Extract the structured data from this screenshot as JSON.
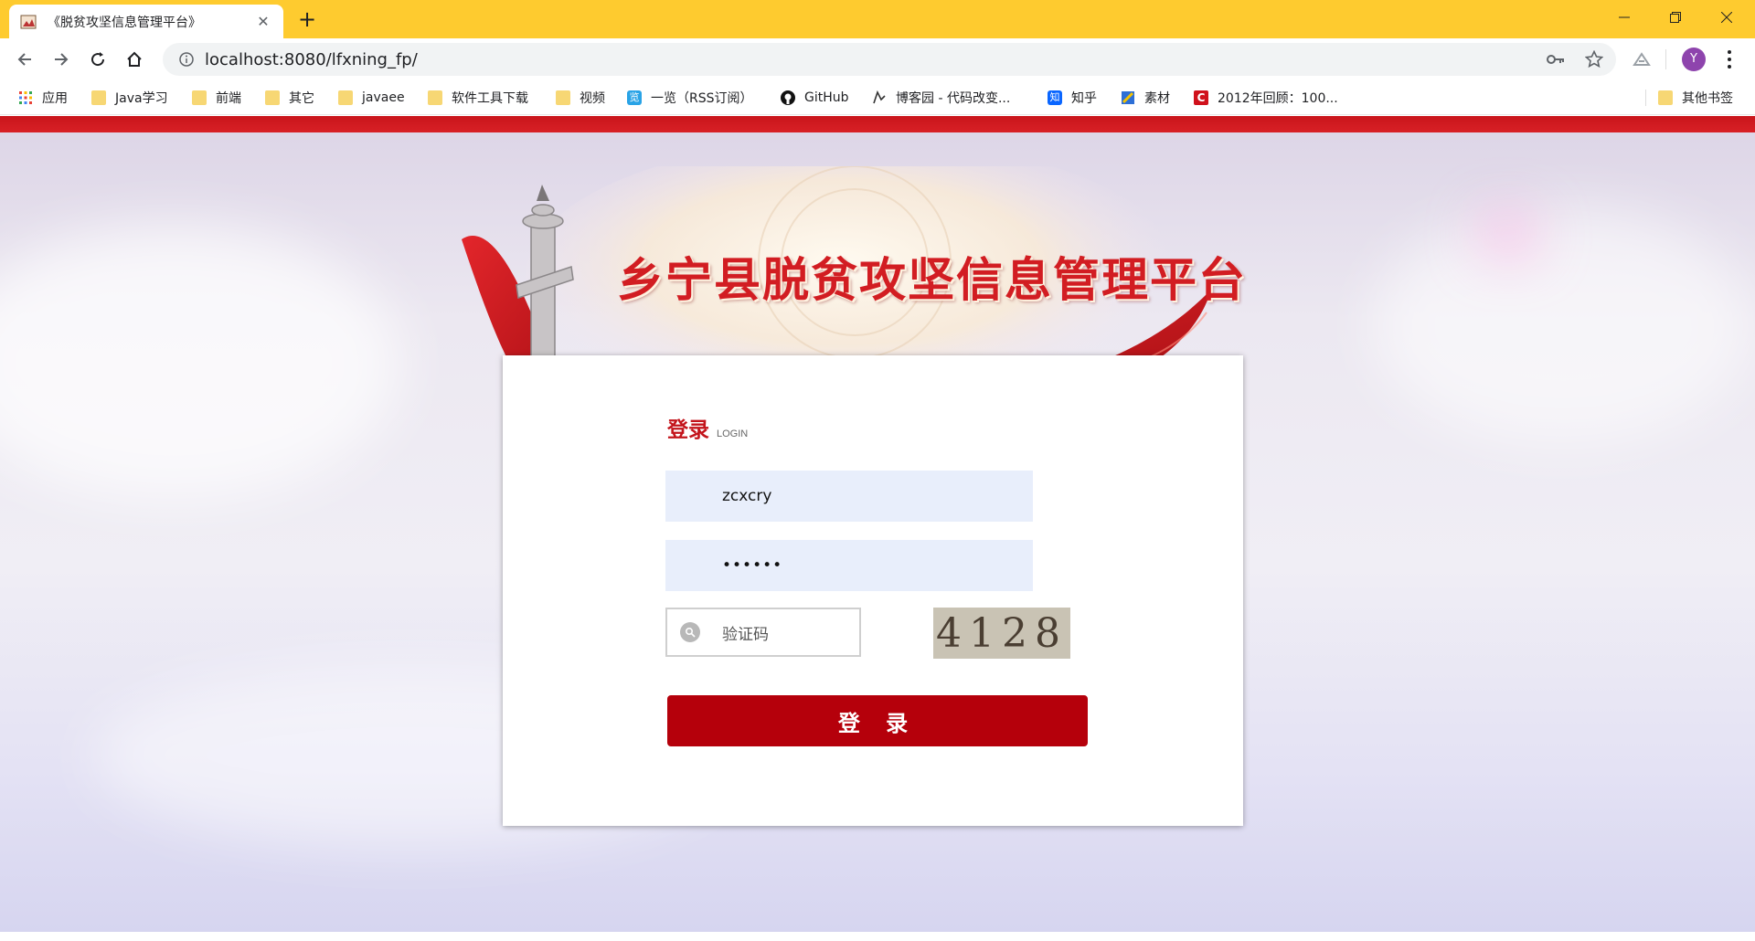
{
  "browser": {
    "tab_title": "《脱贫攻坚信息管理平台》",
    "url": "localhost:8080/lfxning_fp/",
    "profile_initial": "Y",
    "accent": "#fecb2f"
  },
  "bookmarks": [
    {
      "label": "应用",
      "icon": "apps-grid-icon"
    },
    {
      "label": "Java学习",
      "icon": "folder-icon"
    },
    {
      "label": "前端",
      "icon": "folder-icon"
    },
    {
      "label": "其它",
      "icon": "folder-icon"
    },
    {
      "label": "javaee",
      "icon": "folder-icon"
    },
    {
      "label": "软件工具下载",
      "icon": "folder-icon"
    },
    {
      "label": "视频",
      "icon": "folder-icon"
    },
    {
      "label": "一览（RSS订阅）",
      "icon": "rss-icon"
    },
    {
      "label": "GitHub",
      "icon": "github-icon"
    },
    {
      "label": "博客园 - 代码改变...",
      "icon": "cnblogs-icon"
    },
    {
      "label": "知乎",
      "icon": "zhihu-icon"
    },
    {
      "label": "素材",
      "icon": "material-icon"
    },
    {
      "label": "2012年回顾：100...",
      "icon": "c-logo-icon"
    }
  ],
  "other_bookmarks": "其他书签",
  "page": {
    "site_title": "乡宁县脱贫攻坚信息管理平台",
    "login": {
      "title": "登录",
      "subtitle": "LOGIN",
      "username_value": "zcxcry",
      "password_value": "••••••",
      "captcha_placeholder": "验证码",
      "captcha_text": "4128",
      "submit_label": "登 录"
    },
    "brand_red": "#c3141b",
    "button_red": "#b5000b"
  }
}
